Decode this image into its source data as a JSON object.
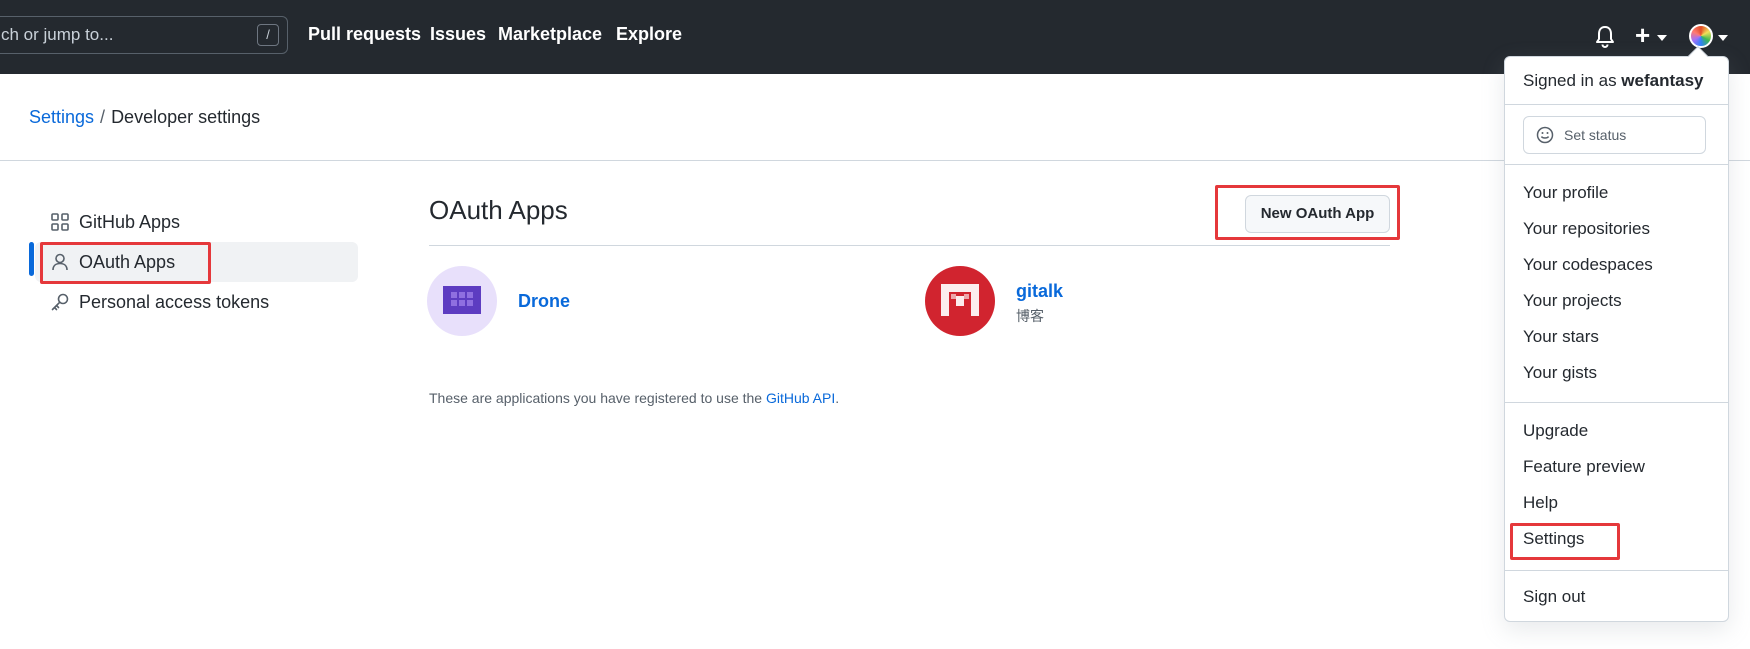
{
  "header": {
    "search_placeholder": "Search or jump to...",
    "search_visible": "ch or jump to...",
    "search_shortcut": "/",
    "nav": [
      "Pull requests",
      "Issues",
      "Marketplace",
      "Explore"
    ],
    "plus_label": "+"
  },
  "breadcrumb": {
    "parent": "Settings",
    "separator": "/",
    "current": "Developer settings"
  },
  "sidebar": {
    "items": [
      {
        "label": "GitHub Apps",
        "icon": "apps-icon"
      },
      {
        "label": "OAuth Apps",
        "icon": "person-icon"
      },
      {
        "label": "Personal access tokens",
        "icon": "key-icon"
      }
    ]
  },
  "main": {
    "title": "OAuth Apps",
    "new_button": "New OAuth App",
    "apps": [
      {
        "name": "Drone",
        "description": ""
      },
      {
        "name": "gitalk",
        "description": "博客"
      }
    ],
    "note_prefix": "These are applications you have registered to use the ",
    "note_link": "GitHub API",
    "note_suffix": "."
  },
  "dropdown": {
    "signed_in_prefix": "Signed in as ",
    "username": "wefantasy",
    "set_status": "Set status",
    "group1": [
      "Your profile",
      "Your repositories",
      "Your codespaces",
      "Your projects",
      "Your stars",
      "Your gists"
    ],
    "group2": [
      "Upgrade",
      "Feature preview",
      "Help",
      "Settings"
    ],
    "sign_out": "Sign out"
  },
  "colors": {
    "header_bg": "#24292f",
    "link": "#0969da",
    "annotation_red": "#e5383b",
    "drone_bg": "#e8e0fb",
    "drone_icon": "#5d3cc1",
    "gitalk_bg": "#d1242f"
  }
}
